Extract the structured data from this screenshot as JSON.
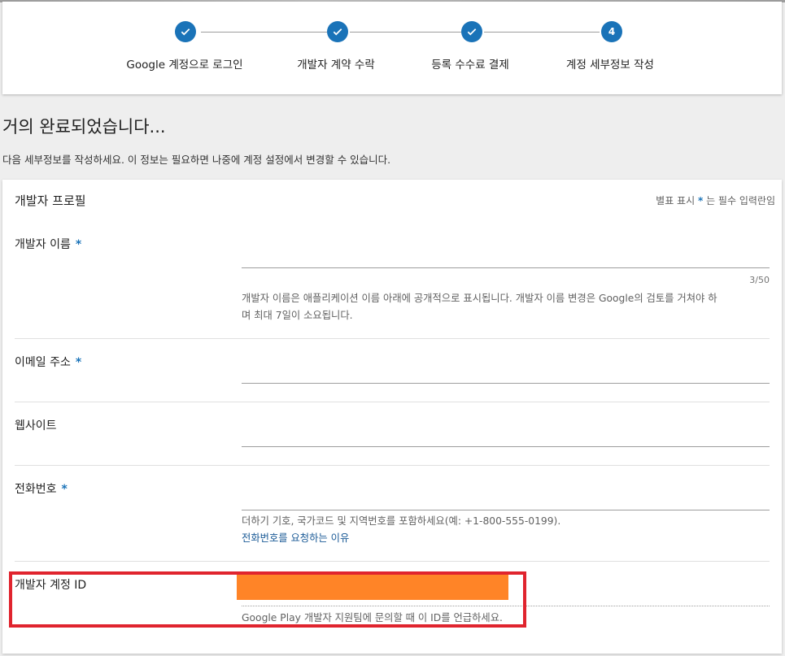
{
  "stepper": {
    "steps": [
      {
        "label": "Google 계정으로 로그인",
        "state": "complete",
        "icon": "check-icon"
      },
      {
        "label": "개발자 계약 수락",
        "state": "complete",
        "icon": "check-icon"
      },
      {
        "label": "등록 수수료 결제",
        "state": "complete",
        "icon": "check-icon"
      },
      {
        "label": "계정 세부정보 작성",
        "state": "current",
        "number": "4"
      }
    ]
  },
  "page": {
    "heading": "거의 완료되었습니다...",
    "subtext": "다음 세부정보를 작성하세요. 이 정보는 필요하면 나중에 계정 설정에서 변경할 수 있습니다."
  },
  "form": {
    "title": "개발자 프로필",
    "required_note_prefix": "별표 표시",
    "required_star": "*",
    "required_note_suffix": "는 필수 입력란임",
    "developer_name": {
      "label": "개발자 이름",
      "required": "*",
      "value": "",
      "counter": "3/50",
      "hint_line1": "개발자 이름은 애플리케이션 이름 아래에 공개적으로 표시됩니다. 개발자 이름 변경은 Google의 검토를 거쳐야 하",
      "hint_line2": "며 최대 7일이 소요됩니다."
    },
    "email": {
      "label": "이메일 주소",
      "required": "*",
      "value": ""
    },
    "website": {
      "label": "웹사이트",
      "value": ""
    },
    "phone": {
      "label": "전화번호",
      "required": "*",
      "value": "",
      "hint": "더하기 기호, 국가코드 및 지역번호를 포함하세요(예: +1-800-555-0199).",
      "link": "전화번호를 요청하는 이유"
    },
    "account_id": {
      "label": "개발자 계정 ID",
      "hint": "Google Play 개발자 지원팀에 문의할 때 이 ID를 언급하세요."
    }
  },
  "colors": {
    "accent": "#1a73b8",
    "redaction": "#ff8427",
    "highlight": "#e0242e"
  }
}
